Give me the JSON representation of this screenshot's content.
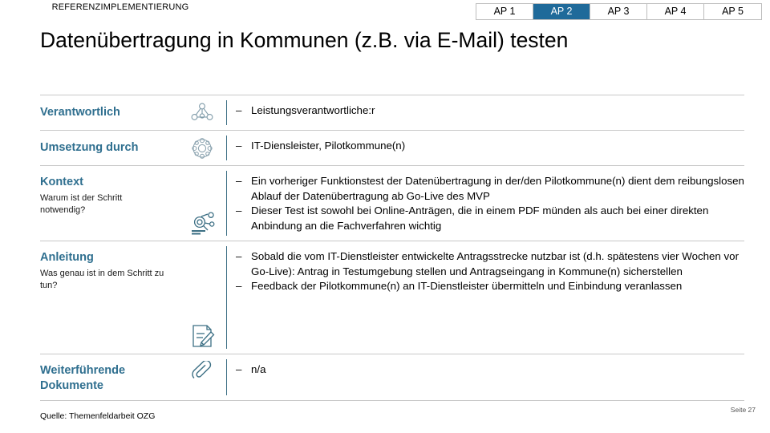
{
  "header": {
    "kicker": "REFERENZIMPLEMENTIERUNG",
    "title": "Datenübertragung in Kommunen (z.B. via E-Mail) testen"
  },
  "tabs": {
    "active_index": 1,
    "active_color": "#1f6a9a",
    "items": [
      {
        "label": "AP 1"
      },
      {
        "label": "AP 2"
      },
      {
        "label": "AP 3"
      },
      {
        "label": "AP 4"
      },
      {
        "label": "AP 5"
      }
    ]
  },
  "rows": [
    {
      "title": "Verantwortlich",
      "subtitle": "",
      "icon": "people-network-icon",
      "bullets": [
        "Leistungsverantwortliche:r"
      ]
    },
    {
      "title": "Umsetzung durch",
      "subtitle": "",
      "icon": "team-circle-icon",
      "bullets": [
        "IT-Diensleister, Pilotkommune(n)"
      ]
    },
    {
      "title": "Kontext",
      "subtitle": "Warum ist der Schritt notwendig?",
      "icon": "magnifier-idea-icon",
      "bullets": [
        "Ein vorheriger Funktionstest der Datenübertragung in der/den Pilotkommune(n) dient dem reibungslosen Ablauf der Datenübertragung ab Go-Live des MVP",
        "Dieser Test ist sowohl bei Online-Anträgen, die in einem PDF münden als auch bei einer direkten Anbindung an die Fachverfahren wichtig"
      ]
    },
    {
      "title": "Anleitung",
      "subtitle": "Was genau ist in dem Schritt zu tun?",
      "icon": "document-pencil-icon",
      "bullets": [
        "Sobald die vom IT-Dienstleister entwickelte Antragsstrecke nutzbar ist (d.h. spätestens vier Wochen vor Go-Live): Antrag in Testumgebung stellen und Antragseingang in Kommune(n) sicherstellen",
        "Feedback der Pilotkommune(n) an IT-Dienstleister übermitteln und Einbindung veranlassen"
      ]
    },
    {
      "title": "Weiterführende Dokumente",
      "subtitle": "",
      "icon": "paperclip-icon",
      "bullets": [
        "n/a"
      ]
    }
  ],
  "footer": {
    "source": "Quelle: Themenfeldarbeit OZG",
    "page": "Seite 27"
  },
  "colors": {
    "label_blue": "#2f6f8f",
    "icon_teal": "#3c6f84",
    "rule_gray": "#c8c8c8",
    "tab_active": "#1f6a9a"
  },
  "bullet_dash": "–"
}
